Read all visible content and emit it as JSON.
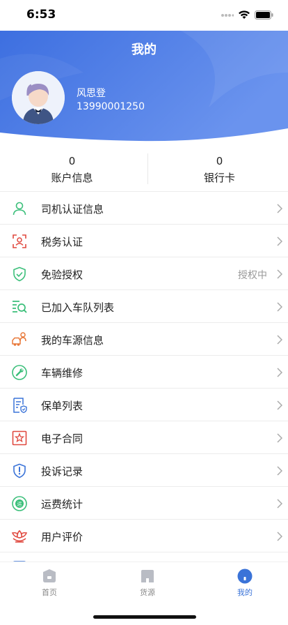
{
  "status_bar": {
    "time": "6:53"
  },
  "header": {
    "title": "我的",
    "user": {
      "name": "风思登",
      "phone": "13990001250"
    },
    "colors": {
      "gradient_start": "#3d6fe0",
      "gradient_end": "#6a93ee"
    }
  },
  "stats": [
    {
      "value": "0",
      "label": "账户信息"
    },
    {
      "value": "0",
      "label": "银行卡"
    }
  ],
  "menu": [
    {
      "label": "司机认证信息",
      "icon": "person-icon",
      "value": ""
    },
    {
      "label": "税务认证",
      "icon": "face-scan-icon",
      "value": ""
    },
    {
      "label": "免验授权",
      "icon": "shield-check-icon",
      "value": "授权中"
    },
    {
      "label": "已加入车队列表",
      "icon": "list-search-icon",
      "value": ""
    },
    {
      "label": "我的车源信息",
      "icon": "car-person-icon",
      "value": ""
    },
    {
      "label": "车辆维修",
      "icon": "wrench-icon",
      "value": ""
    },
    {
      "label": "保单列表",
      "icon": "document-shield-icon",
      "value": ""
    },
    {
      "label": "电子合同",
      "icon": "contract-stamp-icon",
      "value": ""
    },
    {
      "label": "投诉记录",
      "icon": "shield-alert-icon",
      "value": ""
    },
    {
      "label": "运费统计",
      "icon": "freight-icon",
      "value": ""
    },
    {
      "label": "用户评价",
      "icon": "lotus-icon",
      "value": ""
    }
  ],
  "tabbar": [
    {
      "label": "首页",
      "icon": "home-icon",
      "active": false
    },
    {
      "label": "货源",
      "icon": "cargo-icon",
      "active": false
    },
    {
      "label": "我的",
      "icon": "profile-icon",
      "active": true
    }
  ],
  "colors": {
    "accent": "#3a73d8",
    "inactive": "#888888"
  }
}
